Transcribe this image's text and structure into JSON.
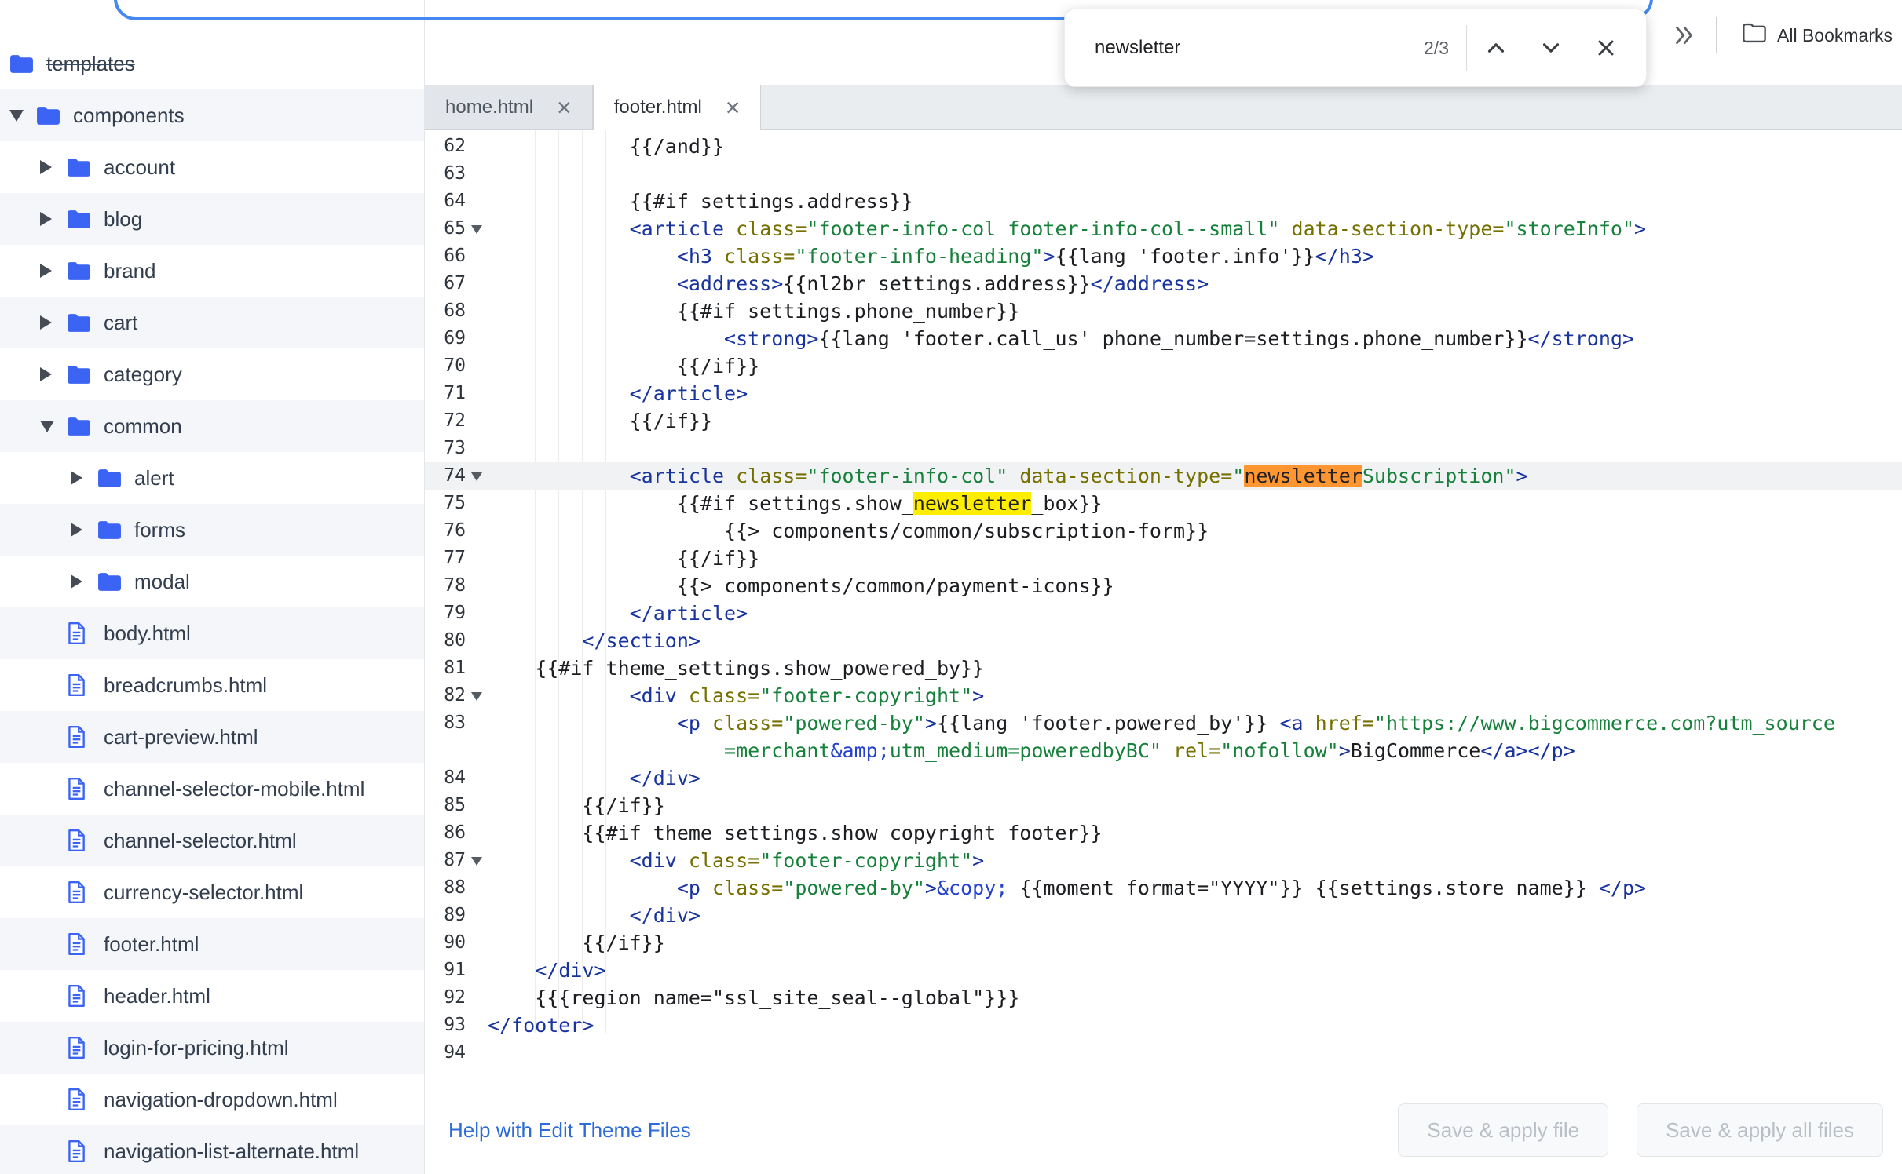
{
  "browser": {
    "find_bar": {
      "query": "newsletter",
      "match_count": "2/3"
    },
    "bookmarks_bar": {
      "all_bookmarks_label": "All Bookmarks"
    }
  },
  "colors": {
    "accent_blue": "#3c64f4",
    "find_active_highlight": "#ff9632",
    "find_match_highlight": "#ffee00"
  },
  "sidebar": {
    "items": [
      {
        "label": "templates",
        "kind": "folder",
        "depth": 0,
        "arrow": null,
        "flush": true,
        "strike": true
      },
      {
        "label": "components",
        "kind": "folder",
        "depth": 0,
        "arrow": "down"
      },
      {
        "label": "account",
        "kind": "folder",
        "depth": 1,
        "arrow": "right"
      },
      {
        "label": "blog",
        "kind": "folder",
        "depth": 1,
        "arrow": "right"
      },
      {
        "label": "brand",
        "kind": "folder",
        "depth": 1,
        "arrow": "right"
      },
      {
        "label": "cart",
        "kind": "folder",
        "depth": 1,
        "arrow": "right"
      },
      {
        "label": "category",
        "kind": "folder",
        "depth": 1,
        "arrow": "right"
      },
      {
        "label": "common",
        "kind": "folder",
        "depth": 1,
        "arrow": "down"
      },
      {
        "label": "alert",
        "kind": "folder",
        "depth": 2,
        "arrow": "right"
      },
      {
        "label": "forms",
        "kind": "folder",
        "depth": 2,
        "arrow": "right"
      },
      {
        "label": "modal",
        "kind": "folder",
        "depth": 2,
        "arrow": "right"
      },
      {
        "label": "body.html",
        "kind": "file",
        "depth": 1
      },
      {
        "label": "breadcrumbs.html",
        "kind": "file",
        "depth": 1
      },
      {
        "label": "cart-preview.html",
        "kind": "file",
        "depth": 1
      },
      {
        "label": "channel-selector-mobile.html",
        "kind": "file",
        "depth": 1
      },
      {
        "label": "channel-selector.html",
        "kind": "file",
        "depth": 1
      },
      {
        "label": "currency-selector.html",
        "kind": "file",
        "depth": 1
      },
      {
        "label": "footer.html",
        "kind": "file",
        "depth": 1
      },
      {
        "label": "header.html",
        "kind": "file",
        "depth": 1
      },
      {
        "label": "login-for-pricing.html",
        "kind": "file",
        "depth": 1
      },
      {
        "label": "navigation-dropdown.html",
        "kind": "file",
        "depth": 1
      },
      {
        "label": "navigation-list-alternate.html",
        "kind": "file",
        "depth": 1
      }
    ]
  },
  "editor": {
    "tabs": [
      {
        "label": "home.html",
        "active": false
      },
      {
        "label": "footer.html",
        "active": true
      }
    ],
    "lines": [
      {
        "n": 62,
        "t": [
          [
            "p",
            "            {{/and}}"
          ]
        ]
      },
      {
        "n": 63,
        "t": []
      },
      {
        "n": 64,
        "t": [
          [
            "p",
            "            {{#if settings.address}}"
          ]
        ]
      },
      {
        "n": 65,
        "fold": true,
        "t": [
          [
            "p",
            "            "
          ],
          [
            "t",
            "<article"
          ],
          [
            "a",
            " class="
          ],
          [
            "s",
            "\"footer-info-col footer-info-col--small\""
          ],
          [
            "a",
            " data-section-type="
          ],
          [
            "s",
            "\"storeInfo\""
          ],
          [
            "t",
            ">"
          ]
        ]
      },
      {
        "n": 66,
        "t": [
          [
            "p",
            "                "
          ],
          [
            "t",
            "<h3"
          ],
          [
            "a",
            " class="
          ],
          [
            "s",
            "\"footer-info-heading\""
          ],
          [
            "t",
            ">"
          ],
          [
            "p",
            "{{lang 'footer.info'}}"
          ],
          [
            "t",
            "</h3>"
          ]
        ]
      },
      {
        "n": 67,
        "t": [
          [
            "p",
            "                "
          ],
          [
            "t",
            "<address>"
          ],
          [
            "p",
            "{{nl2br settings.address}}"
          ],
          [
            "t",
            "</address>"
          ]
        ]
      },
      {
        "n": 68,
        "t": [
          [
            "p",
            "                {{#if settings.phone_number}}"
          ]
        ]
      },
      {
        "n": 69,
        "t": [
          [
            "p",
            "                    "
          ],
          [
            "t",
            "<strong>"
          ],
          [
            "p",
            "{{lang 'footer.call_us' phone_number=settings.phone_number}}"
          ],
          [
            "t",
            "</strong>"
          ]
        ]
      },
      {
        "n": 70,
        "t": [
          [
            "p",
            "                {{/if}}"
          ]
        ]
      },
      {
        "n": 71,
        "t": [
          [
            "p",
            "            "
          ],
          [
            "t",
            "</article>"
          ]
        ]
      },
      {
        "n": 72,
        "t": [
          [
            "p",
            "            {{/if}}"
          ]
        ]
      },
      {
        "n": 73,
        "t": []
      },
      {
        "n": 74,
        "fold": true,
        "active": true,
        "t": [
          [
            "p",
            "            "
          ],
          [
            "t",
            "<article"
          ],
          [
            "a",
            " class="
          ],
          [
            "s",
            "\"footer-info-col\""
          ],
          [
            "a",
            " data-section-type="
          ],
          [
            "s",
            "\""
          ],
          [
            "hA",
            "newsletter"
          ],
          [
            "s",
            "Subscription\""
          ],
          [
            "t",
            ">"
          ]
        ]
      },
      {
        "n": 75,
        "t": [
          [
            "p",
            "                {{#if settings.show_"
          ],
          [
            "hY",
            "newsletter"
          ],
          [
            "p",
            "_box}}"
          ]
        ]
      },
      {
        "n": 76,
        "t": [
          [
            "p",
            "                    {{> components/common/subscription-form}}"
          ]
        ]
      },
      {
        "n": 77,
        "t": [
          [
            "p",
            "                {{/if}}"
          ]
        ]
      },
      {
        "n": 78,
        "t": [
          [
            "p",
            "                {{> components/common/payment-icons}}"
          ]
        ]
      },
      {
        "n": 79,
        "t": [
          [
            "p",
            "            "
          ],
          [
            "t",
            "</article>"
          ]
        ]
      },
      {
        "n": 80,
        "t": [
          [
            "p",
            "        "
          ],
          [
            "t",
            "</section>"
          ]
        ]
      },
      {
        "n": 81,
        "t": [
          [
            "p",
            "    {{#if theme_settings.show_powered_by}}"
          ]
        ]
      },
      {
        "n": 82,
        "fold": true,
        "t": [
          [
            "p",
            "            "
          ],
          [
            "t",
            "<div"
          ],
          [
            "a",
            " class="
          ],
          [
            "s",
            "\"footer-copyright\""
          ],
          [
            "t",
            ">"
          ]
        ]
      },
      {
        "n": 83,
        "t": [
          [
            "p",
            "                "
          ],
          [
            "t",
            "<p"
          ],
          [
            "a",
            " class="
          ],
          [
            "s",
            "\"powered-by\""
          ],
          [
            "t",
            ">"
          ],
          [
            "p",
            "{{lang 'footer.powered_by'}} "
          ],
          [
            "t",
            "<a"
          ],
          [
            "a",
            " href="
          ],
          [
            "s",
            "\"https://www.bigcommerce.com?utm_source"
          ],
          [
            "s",
            "\n                    =merchant"
          ],
          [
            "e",
            "&amp;"
          ],
          [
            "s",
            "utm_medium=poweredbyBC\""
          ],
          [
            "a",
            " rel="
          ],
          [
            "s",
            "\"nofollow\""
          ],
          [
            "t",
            ">"
          ],
          [
            "p",
            "BigCommerce"
          ],
          [
            "t",
            "</a></p>"
          ]
        ]
      },
      {
        "n": 84,
        "t": [
          [
            "p",
            "            "
          ],
          [
            "t",
            "</div>"
          ]
        ]
      },
      {
        "n": 85,
        "t": [
          [
            "p",
            "        {{/if}}"
          ]
        ]
      },
      {
        "n": 86,
        "t": [
          [
            "p",
            "        {{#if theme_settings.show_copyright_footer}}"
          ]
        ]
      },
      {
        "n": 87,
        "fold": true,
        "t": [
          [
            "p",
            "            "
          ],
          [
            "t",
            "<div"
          ],
          [
            "a",
            " class="
          ],
          [
            "s",
            "\"footer-copyright\""
          ],
          [
            "t",
            ">"
          ]
        ]
      },
      {
        "n": 88,
        "t": [
          [
            "p",
            "                "
          ],
          [
            "t",
            "<p"
          ],
          [
            "a",
            " class="
          ],
          [
            "s",
            "\"powered-by\""
          ],
          [
            "t",
            ">"
          ],
          [
            "e",
            "&copy;"
          ],
          [
            "p",
            " {{moment format=\"YYYY\"}} {{settings.store_name}} "
          ],
          [
            "t",
            "</p>"
          ]
        ]
      },
      {
        "n": 89,
        "t": [
          [
            "p",
            "            "
          ],
          [
            "t",
            "</div>"
          ]
        ]
      },
      {
        "n": 90,
        "t": [
          [
            "p",
            "        {{/if}}"
          ]
        ]
      },
      {
        "n": 91,
        "t": [
          [
            "p",
            "    "
          ],
          [
            "t",
            "</div>"
          ]
        ]
      },
      {
        "n": 92,
        "t": [
          [
            "p",
            "    {{{region name=\"ssl_site_seal--global\"}}}"
          ]
        ]
      },
      {
        "n": 93,
        "t": [
          [
            "t",
            "</footer>"
          ]
        ]
      },
      {
        "n": 94,
        "t": []
      }
    ]
  },
  "footer_bar": {
    "help_link_label": "Help with Edit Theme Files",
    "save_file_label": "Save & apply file",
    "save_all_label": "Save & apply all files"
  }
}
